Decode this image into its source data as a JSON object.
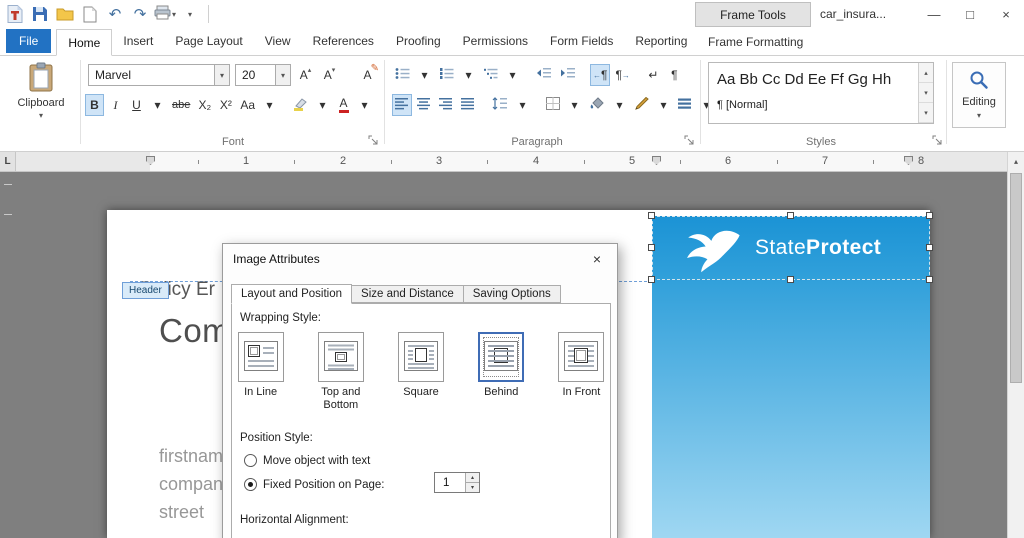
{
  "titlebar": {
    "frame_tools_label": "Frame Tools",
    "document_title": "car_insura..."
  },
  "icons": {
    "caret": "▾",
    "caret_up": "▴",
    "undo": "↶",
    "redo": "↷",
    "minimize": "—",
    "maximize": "□",
    "close": "×",
    "pilcrow": "¶",
    "arrow_left": "←",
    "arrow_right": "→",
    "return": "↵"
  },
  "ribbon_tabs": [
    {
      "label": "File"
    },
    {
      "label": "Home"
    },
    {
      "label": "Insert"
    },
    {
      "label": "Page Layout"
    },
    {
      "label": "View"
    },
    {
      "label": "References"
    },
    {
      "label": "Proofing"
    },
    {
      "label": "Permissions"
    },
    {
      "label": "Form Fields"
    },
    {
      "label": "Reporting"
    },
    {
      "label": "Frame Formatting"
    }
  ],
  "ribbon": {
    "clipboard": {
      "label": "Clipboard"
    },
    "font": {
      "group_label": "Font",
      "name": "Marvel",
      "size": "20",
      "bold": "B",
      "italic": "I",
      "underline": "U",
      "strikethrough": "abe",
      "subscript": "X₂",
      "superscript": "X²",
      "change_case": "Aa",
      "color_letter": "A",
      "grow_letter": "A",
      "shrink_letter": "A",
      "reset_letter": "A"
    },
    "paragraph": {
      "group_label": "Paragraph"
    },
    "styles": {
      "group_label": "Styles",
      "preview": "Aa Bb Cc Dd Ee Ff Gg Hh",
      "style_name": "¶ [Normal]"
    },
    "editing": {
      "label": "Editing"
    }
  },
  "ruler": {
    "tab_selector": "L",
    "numbers": [
      "1",
      "2",
      "3",
      "4",
      "5",
      "6",
      "7",
      "8"
    ]
  },
  "document": {
    "header_tag": "Header",
    "heading_line": "Policy Er",
    "big_heading": "Comp",
    "placeholder_lines": [
      "firstnam",
      "compan",
      "street"
    ],
    "logo": {
      "part1": "State",
      "part2": "Protect"
    }
  },
  "dialog": {
    "title": "Image Attributes",
    "tabs": [
      {
        "label": "Layout and Position"
      },
      {
        "label": "Size and Distance"
      },
      {
        "label": "Saving Options"
      }
    ],
    "wrapping_label": "Wrapping Style:",
    "wrapping_options": [
      {
        "label": "In Line"
      },
      {
        "label": "Top and Bottom"
      },
      {
        "label": "Square"
      },
      {
        "label": "Behind"
      },
      {
        "label": "In Front"
      }
    ],
    "position_label": "Position Style:",
    "move_with_text": "Move object with text",
    "fixed_position": "Fixed Position on Page:",
    "page_number": "1",
    "horizontal_label": "Horizontal Alignment:"
  },
  "colors": {
    "accent_blue": "#2272c3",
    "active_highlight": "#cfe4f7",
    "workspace_gray": "#7f7f7f",
    "doc_gradient_top": "#1b93d5",
    "doc_gradient_bottom": "#9fd7f2"
  }
}
